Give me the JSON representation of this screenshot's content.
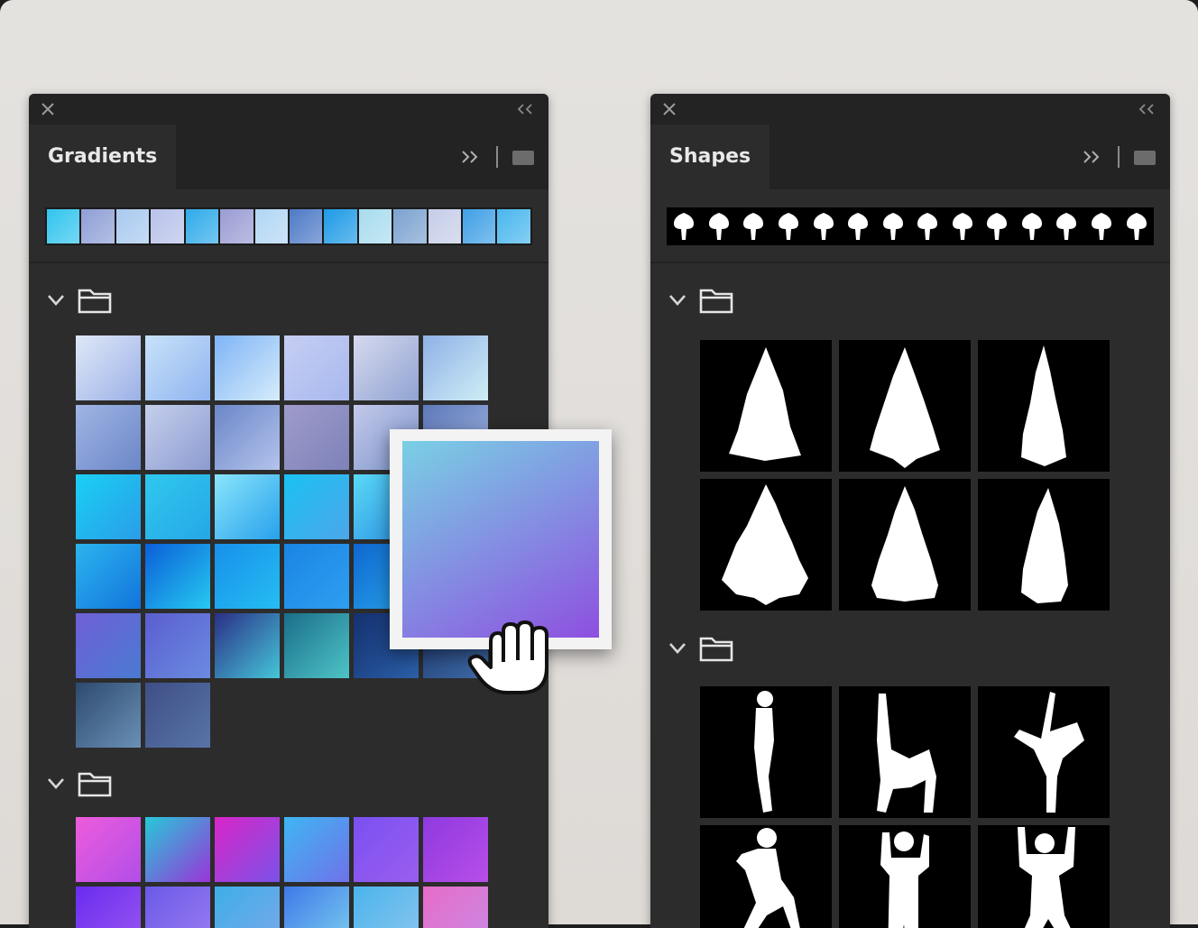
{
  "gradients_panel": {
    "tab_label": "Gradients",
    "strip": [
      "#31c4ee",
      "#8e9fd6",
      "#a9c9ef",
      "#b8c2ea",
      "#2eaae9",
      "#9a9cd4",
      "#b2d6f4",
      "#4d7ac6",
      "#1d9ae6",
      "#a8dcee",
      "#7ba2d0",
      "#c6cde8",
      "#3fa0e6",
      "#49b6ee"
    ],
    "groups": [
      {
        "cells": [
          [
            "#dfe8f8",
            "#9bb0e6"
          ],
          [
            "#c9e2fa",
            "#8fb4ef"
          ],
          [
            "#7fb4f6",
            "#d6ecfb"
          ],
          [
            "#c6cff3",
            "#a8b8ee"
          ],
          [
            "#d7d9ee",
            "#8fa3d2"
          ],
          [
            "#8fb1e6",
            "#cfeef6"
          ],
          [
            "#a0b5e4",
            "#6c87c8"
          ],
          [
            "#c5cfec",
            "#8c9bd0"
          ],
          [
            "#6c87c8",
            "#b3c3ec"
          ],
          [
            "#9f9bcb",
            "#7d82b8"
          ],
          [
            "#c4c9ea",
            "#7d95cb"
          ],
          [
            "#5e79b9",
            "#9fb5e1"
          ],
          [
            "#1ad0f4",
            "#2a9de8"
          ],
          [
            "#2fc8ee",
            "#25a7e6"
          ],
          [
            "#8ae5fb",
            "#27a1ec"
          ],
          [
            "#1ac2f2",
            "#4da6ea"
          ],
          [
            "#5ad9f6",
            "#2a8de0"
          ],
          [
            "#36b2ec",
            "#1a80d2"
          ],
          [
            "#2cb4ee",
            "#1274dc"
          ],
          [
            "#0b5fd8",
            "#26c9f1"
          ],
          [
            "#1790ea",
            "#25bdf2"
          ],
          [
            "#1a84e4",
            "#2e9ff0"
          ],
          [
            "#0e66cf",
            "#2aa8ec"
          ],
          [
            "#1874d8",
            "#3eb6f0"
          ],
          [
            "#6f5fd6",
            "#4a7ad2"
          ],
          [
            "#5b5ed0",
            "#6a8be0"
          ],
          [
            "#2b2f86",
            "#45c6d8"
          ],
          [
            "#1a6e8a",
            "#4ec4c6"
          ],
          [
            "#14306e",
            "#2b5fa8"
          ],
          [
            "#203a70",
            "#3e6aa6"
          ],
          [
            "#2e4a6e",
            "#6a90b6"
          ],
          [
            "#3e4f86",
            "#5874a8"
          ]
        ]
      },
      {
        "cells": [
          [
            "#ee5cdc",
            "#b14ee8"
          ],
          [
            "#26c9d8",
            "#9a34d8"
          ],
          [
            "#d926c8",
            "#7a52e8"
          ],
          [
            "#3fb6f2",
            "#6f72ea"
          ],
          [
            "#7a50f0",
            "#9b5ef0"
          ],
          [
            "#8e3ae0",
            "#b84ee8"
          ],
          [
            "#6a2cf0",
            "#9a58f0"
          ],
          [
            "#6a5ae8",
            "#9d7cf0"
          ],
          [
            "#3daee8",
            "#7da8ea"
          ],
          [
            "#3e7ae8",
            "#7ed0f0"
          ],
          [
            "#4bb4ec",
            "#8cc6ee"
          ],
          [
            "#e66cc8",
            "#c98ae6"
          ]
        ]
      }
    ],
    "preview": {
      "color_start": "#79d0e4",
      "color_end": "#8e4fe0"
    }
  },
  "shapes_panel": {
    "tab_label": "Shapes",
    "strip_count": 14,
    "groups": [
      {
        "shapes": [
          "tree-fir-1",
          "tree-fir-2",
          "tree-cypress",
          "tree-pine-3",
          "tree-spruce",
          "tree-cypress-2"
        ]
      },
      {
        "shapes": [
          "figure-standing",
          "figure-backbend",
          "figure-leg-lift",
          "figure-crouch",
          "figure-flex",
          "figure-arms-up"
        ]
      }
    ]
  }
}
